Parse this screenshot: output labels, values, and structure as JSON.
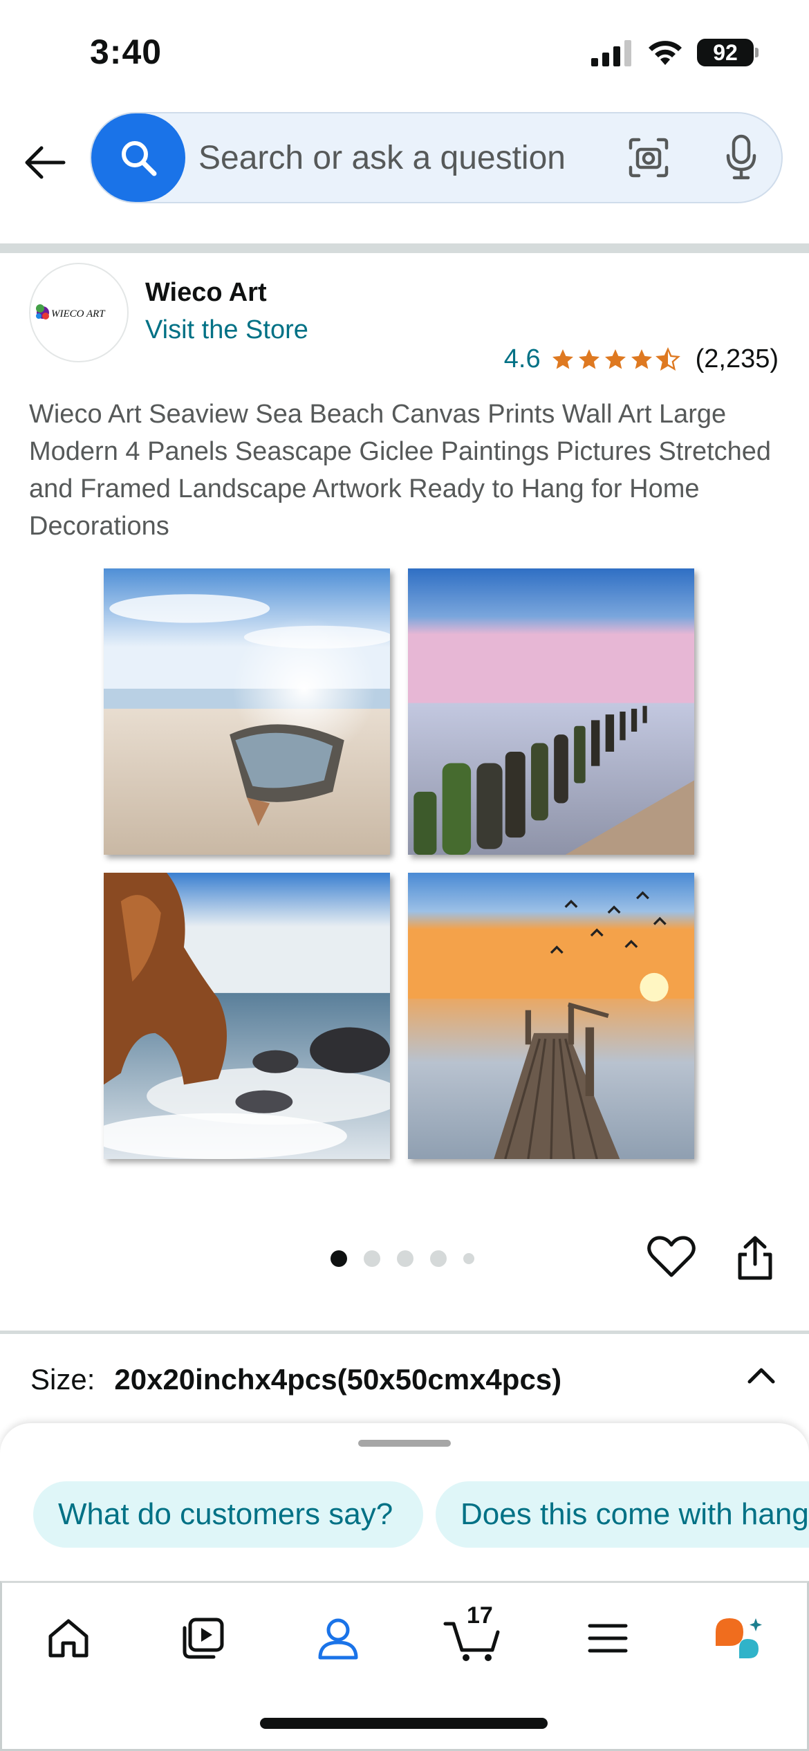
{
  "status_bar": {
    "time": "3:40",
    "battery": "92"
  },
  "search": {
    "placeholder": "Search or ask a question",
    "accent_color": "#1a73e8"
  },
  "store": {
    "name": "Wieco Art",
    "logo_text": "WIECO ART",
    "link_label": "Visit the Store"
  },
  "rating": {
    "value": "4.6",
    "stars": 4.5,
    "count": "(2,235)",
    "star_color": "#de7921"
  },
  "product": {
    "title": "Wieco Art Seaview Sea Beach Canvas Prints Wall Art Large Modern 4 Panels Seascape Giclee Paintings Pictures Stretched and Framed Landscape Artwork Ready to Hang for Home Decorations",
    "image_panels": [
      "boat-on-beach",
      "wooden-groynes-sea",
      "rock-arch-waves",
      "wooden-pier-sunset"
    ]
  },
  "carousel": {
    "total": 5,
    "active_index": 0
  },
  "size": {
    "label": "Size:",
    "value": "20x20inchx4pcs(50x50cmx4pcs)"
  },
  "suggestions": {
    "chips": [
      "What do customers say?",
      "Does this come with hang"
    ]
  },
  "bottom_nav": {
    "items": [
      "home-icon",
      "video-icon",
      "account-icon",
      "cart-icon",
      "menu-icon",
      "rufus-icon"
    ],
    "active": "account-icon",
    "cart_count": "17",
    "active_color": "#1a73e8"
  }
}
